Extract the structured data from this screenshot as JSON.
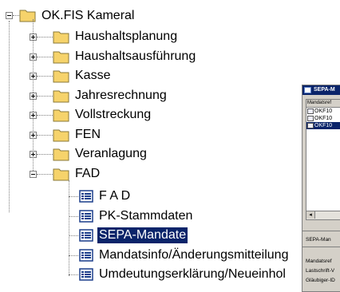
{
  "tree": {
    "root": {
      "label": "OK.FIS Kameral",
      "expander": "minus"
    },
    "folders": [
      {
        "label": "Haushaltsplanung",
        "expander": "plus"
      },
      {
        "label": "Haushaltsausführung",
        "expander": "plus"
      },
      {
        "label": "Kasse",
        "expander": "plus"
      },
      {
        "label": "Jahresrechnung",
        "expander": "plus"
      },
      {
        "label": "Vollstreckung",
        "expander": "plus"
      },
      {
        "label": "FEN",
        "expander": "plus"
      },
      {
        "label": "Veranlagung",
        "expander": "plus"
      },
      {
        "label": "FAD",
        "expander": "minus"
      }
    ],
    "fad_items": [
      {
        "label": "F A D",
        "selected": false
      },
      {
        "label": "PK-Stammdaten",
        "selected": false
      },
      {
        "label": "SEPA-Mandate",
        "selected": true
      },
      {
        "label": "Mandatsinfo/Änderungsmitteilung",
        "selected": false
      },
      {
        "label": "Umdeutungserklärung/Neueinhol",
        "selected": false
      }
    ]
  },
  "background_window": {
    "title": "SEPA-M",
    "column_header": "Mandatsref",
    "rows": [
      {
        "text": "OKF10",
        "selected": false
      },
      {
        "text": "OKF10",
        "selected": false
      },
      {
        "text": "OKF10",
        "selected": true
      }
    ],
    "scroll_left": "◂",
    "section_label": "SEPA-Man",
    "field_labels": [
      "Mandatsref",
      "Lastschrift-V",
      "Gläubiger-ID"
    ]
  },
  "colors": {
    "selection": "#0a246a",
    "folder": "#f6d36b",
    "window_face": "#d4d0c8"
  }
}
